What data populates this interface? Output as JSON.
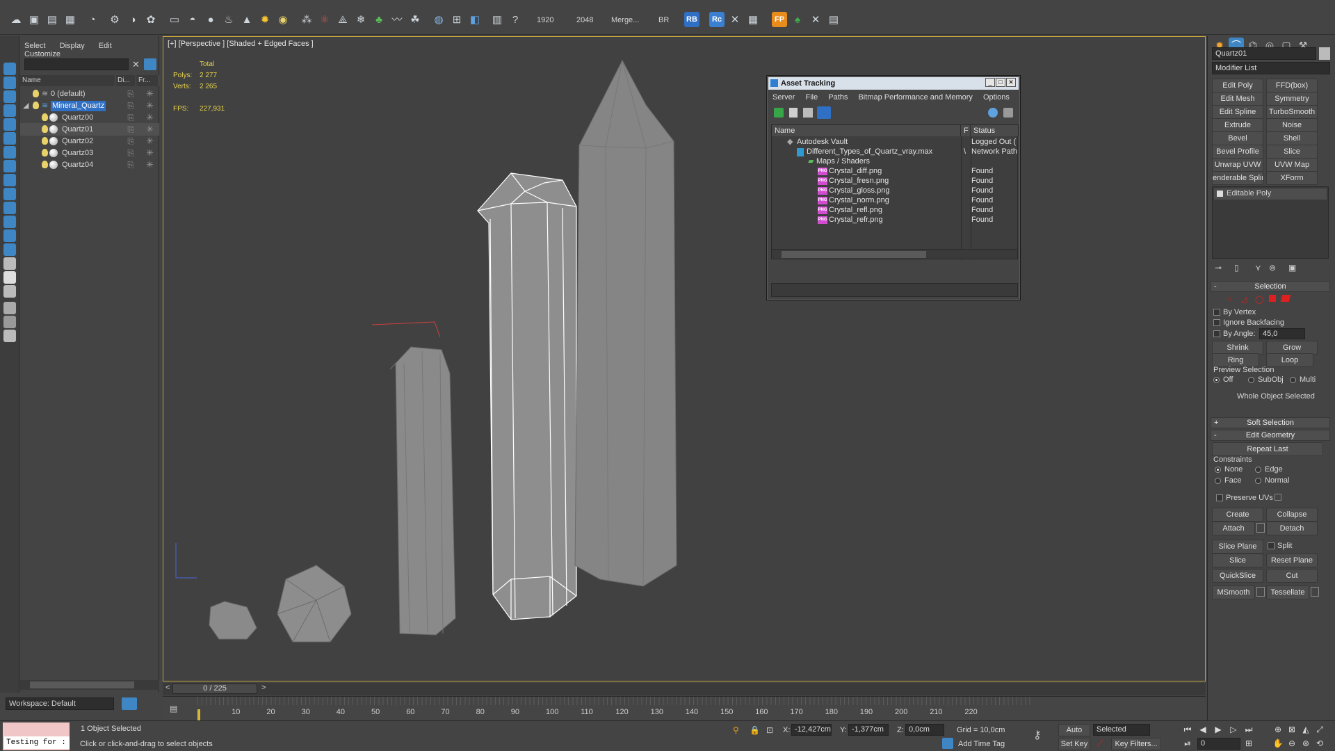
{
  "toolbar": {
    "render_width": "1920",
    "render_height": "2048",
    "merge_label": "Merge...",
    "br_label": "BR",
    "rb_label": "RB",
    "rc_label": "Rc",
    "fp_label": "FP"
  },
  "explorer": {
    "menu": [
      "Select",
      "Display",
      "Edit",
      "Customize"
    ],
    "columns": [
      "Name",
      "Di...",
      "Fr..."
    ],
    "layers": [
      {
        "name": "0 (default)",
        "level": 0
      },
      {
        "name": "Mineral_Quartz",
        "level": 0
      },
      {
        "name": "Quartz00",
        "level": 1
      },
      {
        "name": "Quartz01",
        "level": 1
      },
      {
        "name": "Quartz02",
        "level": 1
      },
      {
        "name": "Quartz03",
        "level": 1
      },
      {
        "name": "Quartz04",
        "level": 1
      }
    ],
    "selected_item": "Quartz01",
    "workspace": "Workspace: Default"
  },
  "viewport": {
    "label": "[+] [Perspective ] [Shaded + Edged Faces ]",
    "stats_header": "Total",
    "polys_label": "Polys:",
    "polys_value": "2 277",
    "verts_label": "Verts:",
    "verts_value": "2 265",
    "fps_label": "FPS:",
    "fps_value": "227,931"
  },
  "asset_tracking": {
    "title": "Asset Tracking",
    "menu": [
      "Server",
      "File",
      "Paths",
      "Bitmap Performance and Memory",
      "Options"
    ],
    "columns": [
      "Name",
      "F",
      "Status"
    ],
    "rows": [
      {
        "name": "Autodesk Vault",
        "f": "",
        "status": "Logged Out (",
        "indent": 0,
        "icon": "vault"
      },
      {
        "name": "Different_Types_of_Quartz_vray.max",
        "f": "\\",
        "status": "Network Path",
        "indent": 1,
        "icon": "max"
      },
      {
        "name": "Maps / Shaders",
        "f": "",
        "status": "",
        "indent": 2,
        "icon": "folder"
      },
      {
        "name": "Crystal_diff.png",
        "f": "",
        "status": "Found",
        "indent": 3,
        "icon": "png"
      },
      {
        "name": "Crystal_fresn.png",
        "f": "",
        "status": "Found",
        "indent": 3,
        "icon": "png"
      },
      {
        "name": "Crystal_gloss.png",
        "f": "",
        "status": "Found",
        "indent": 3,
        "icon": "png"
      },
      {
        "name": "Crystal_norm.png",
        "f": "",
        "status": "Found",
        "indent": 3,
        "icon": "png"
      },
      {
        "name": "Crystal_refl.png",
        "f": "",
        "status": "Found",
        "indent": 3,
        "icon": "png"
      },
      {
        "name": "Crystal_refr.png",
        "f": "",
        "status": "Found",
        "indent": 3,
        "icon": "png"
      }
    ]
  },
  "command_panel": {
    "object_name": "Quartz01",
    "modifier_list": "Modifier List",
    "modifier_buttons": [
      "Edit Poly",
      "FFD(box)",
      "Edit Mesh",
      "Symmetry",
      "Edit Spline",
      "TurboSmooth",
      "Extrude",
      "Noise",
      "Bevel",
      "Shell",
      "Bevel Profile",
      "Slice",
      "Unwrap UVW",
      "UVW Map",
      "enderable Splin",
      "XForm"
    ],
    "stack_item": "Editable Poly",
    "selection": {
      "title": "Selection",
      "by_vertex": "By Vertex",
      "ignore_backfacing": "Ignore Backfacing",
      "by_angle": "By Angle:",
      "angle_value": "45,0",
      "shrink": "Shrink",
      "grow": "Grow",
      "ring": "Ring",
      "loop": "Loop",
      "preview_selection": "Preview Selection",
      "preview_options": [
        "Off",
        "SubObj",
        "Multi"
      ],
      "status": "Whole Object Selected"
    },
    "soft_selection": "Soft Selection",
    "edit_geometry": {
      "title": "Edit Geometry",
      "repeat_last": "Repeat Last",
      "constraints": "Constraints",
      "constraint_options": [
        "None",
        "Edge",
        "Face",
        "Normal"
      ],
      "preserve_uvs": "Preserve UVs",
      "create": "Create",
      "collapse": "Collapse",
      "attach": "Attach",
      "detach": "Detach",
      "slice_plane": "Slice Plane",
      "split": "Split",
      "slice": "Slice",
      "reset_plane": "Reset Plane",
      "quickslice": "QuickSlice",
      "cut": "Cut",
      "msmooth": "MSmooth",
      "tessellate": "Tessellate"
    }
  },
  "timeline": {
    "frame_counter": "0 / 225",
    "ticks": [
      "10",
      "20",
      "30",
      "40",
      "50",
      "60",
      "70",
      "80",
      "90",
      "100",
      "110",
      "120",
      "130",
      "140",
      "150",
      "160",
      "170",
      "180",
      "190",
      "200",
      "210",
      "220"
    ]
  },
  "status": {
    "maxscript": "Testing for :",
    "objects_selected": "1 Object Selected",
    "prompt": "Click or click-and-drag to select objects",
    "x_label": "X:",
    "x_value": "-12,427cm",
    "y_label": "Y:",
    "y_value": "-1,377cm",
    "z_label": "Z:",
    "z_value": "0,0cm",
    "grid": "Grid = 10,0cm",
    "add_time_tag": "Add Time Tag",
    "auto_key": "Auto Key",
    "set_key": "Set Key",
    "selected_dropdown": "Selected",
    "key_filters": "Key Filters...",
    "current_frame": "0"
  },
  "colors": {
    "viewport_border": "#c3a23a",
    "stats_text": "#e8d44d",
    "highlight_blue": "#3f86c4",
    "selection_red": "#e02020"
  }
}
